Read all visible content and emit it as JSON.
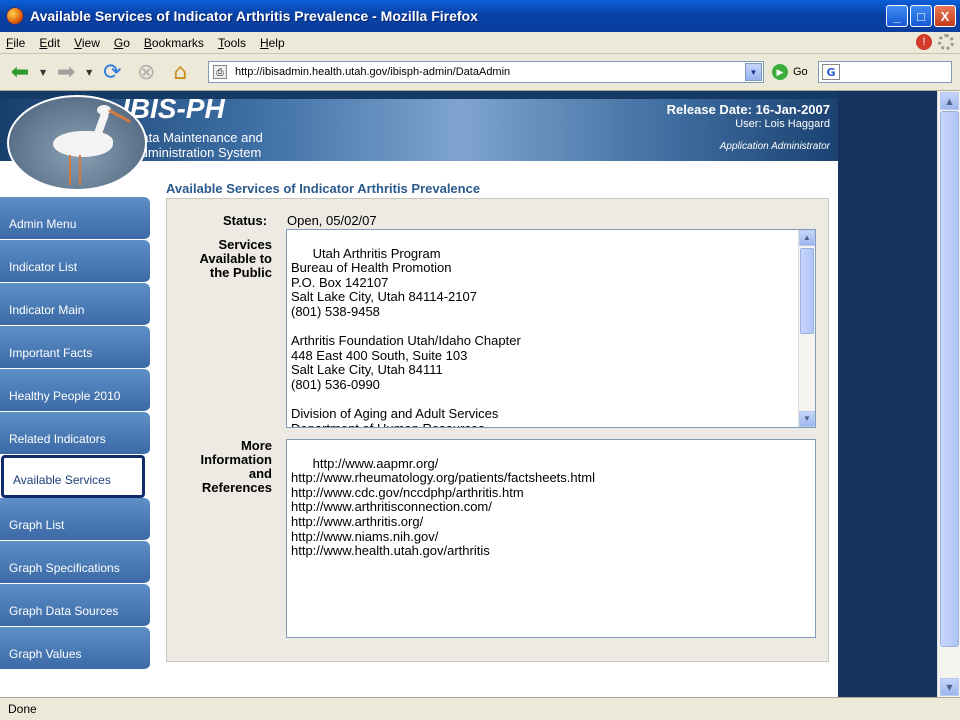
{
  "window": {
    "title": "Available Services of Indicator Arthritis Prevalence - Mozilla Firefox",
    "minimize": "_",
    "maximize": "□",
    "close": "X"
  },
  "menu": [
    "File",
    "Edit",
    "View",
    "Go",
    "Bookmarks",
    "Tools",
    "Help"
  ],
  "toolbar": {
    "url": "http://ibisadmin.health.utah.gov/ibisph-admin/DataAdmin",
    "go_label": "Go",
    "search_value": ""
  },
  "banner": {
    "title": "IBIS-PH",
    "subtitle_line1": "Data Maintenance and",
    "subtitle_line2": "Administration System",
    "release": "Release Date: 16-Jan-2007",
    "user": "User: Lois Haggard",
    "role": "Application Administrator"
  },
  "sidebar": {
    "items": [
      {
        "label": "Admin Menu"
      },
      {
        "label": "Indicator List"
      },
      {
        "label": "Indicator Main"
      },
      {
        "label": "Important Facts"
      },
      {
        "label": "Healthy People 2010"
      },
      {
        "label": "Related Indicators"
      },
      {
        "label": "Available Services",
        "active": true
      },
      {
        "label": "Graph List"
      },
      {
        "label": "Graph Specifications"
      },
      {
        "label": "Graph Data Sources"
      },
      {
        "label": "Graph Values"
      }
    ]
  },
  "content": {
    "title": "Available Services of Indicator Arthritis Prevalence",
    "status_label": "Status:",
    "status_value": "Open,  05/02/07",
    "services_label_1": "Services",
    "services_label_2": "Available to",
    "services_label_3": "the Public",
    "services_text": "Utah Arthritis Program\nBureau of Health Promotion\nP.O. Box 142107\nSalt Lake City, Utah 84114-2107\n(801) 538-9458\n\nArthritis Foundation Utah/Idaho Chapter\n448 East 400 South, Suite 103\nSalt Lake City, Utah 84111\n(801) 536-0990\n\nDivision of Aging and Adult Services\nDepartment of Human Resources",
    "more_label_1": "More",
    "more_label_2": "Information",
    "more_label_3": "and",
    "more_label_4": "References",
    "references_text": "http://www.aapmr.org/\nhttp://www.rheumatology.org/patients/factsheets.html\nhttp://www.cdc.gov/nccdphp/arthritis.htm\nhttp://www.arthritisconnection.com/\nhttp://www.arthritis.org/\nhttp://www.niams.nih.gov/\nhttp://www.health.utah.gov/arthritis"
  },
  "statusbar": {
    "text": "Done"
  }
}
